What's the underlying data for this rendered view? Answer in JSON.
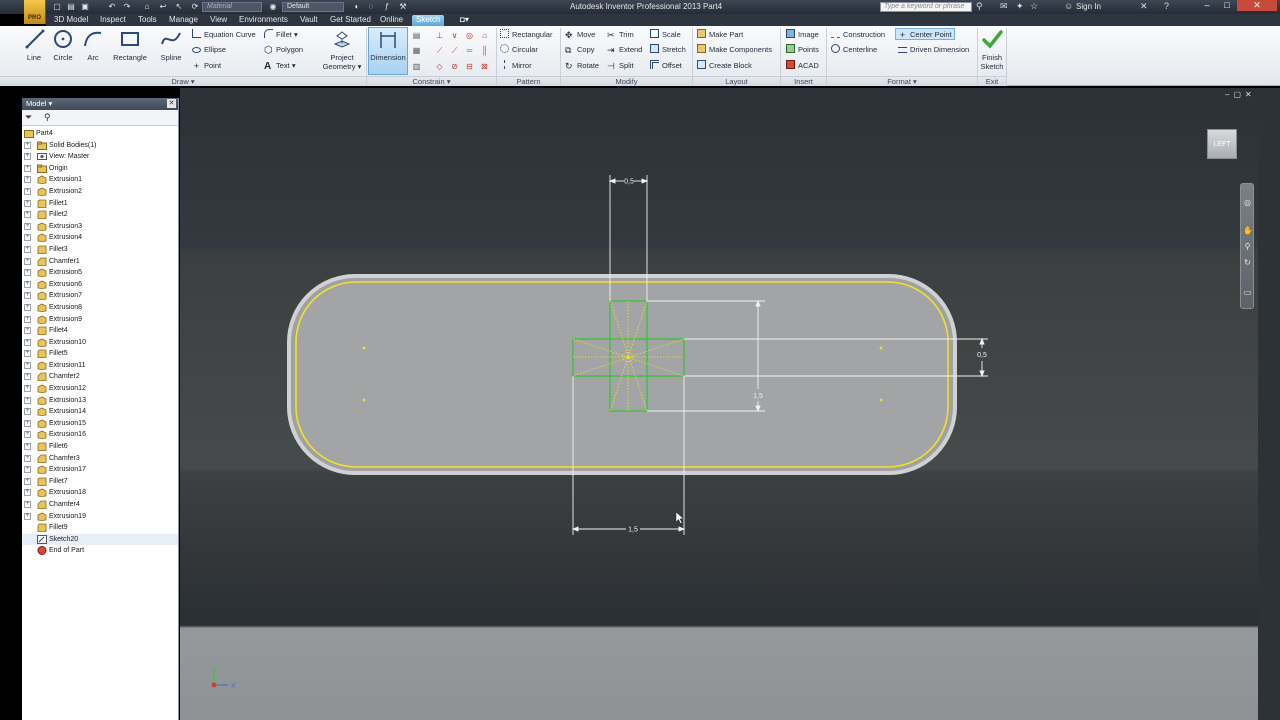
{
  "app": {
    "title": "Autodesk Inventor Professional 2013    Part4",
    "logo_text": "PRO",
    "qa_material": "Material",
    "qa_appearance": "Default",
    "help_placeholder": "Type a keyword or phrase",
    "sign_in": "Sign In"
  },
  "tabs": [
    {
      "label": "3D Model"
    },
    {
      "label": "Inspect"
    },
    {
      "label": "Tools"
    },
    {
      "label": "Manage"
    },
    {
      "label": "View"
    },
    {
      "label": "Environments"
    },
    {
      "label": "Vault"
    },
    {
      "label": "Get Started"
    },
    {
      "label": "Online"
    },
    {
      "label": "Sketch"
    }
  ],
  "ribbon": {
    "draw": {
      "line": "Line",
      "circle": "Circle",
      "arc": "Arc",
      "rectangle": "Rectangle",
      "spline": "Spline",
      "equation_curve": "Equation Curve",
      "ellipse": "Ellipse",
      "point": "Point",
      "fillet": "Fillet",
      "polygon": "Polygon",
      "text": "Text",
      "project_geometry_1": "Project",
      "project_geometry_2": "Geometry"
    },
    "constrain": {
      "dimension": "Dimension"
    },
    "pattern": {
      "rectangular": "Rectangular",
      "circular": "Circular",
      "mirror": "Mirror"
    },
    "modify": {
      "move": "Move",
      "copy": "Copy",
      "rotate": "Rotate",
      "trim": "Trim",
      "extend": "Extend",
      "split": "Split",
      "scale": "Scale",
      "stretch": "Stretch",
      "offset": "Offset"
    },
    "layout": {
      "make_part": "Make Part",
      "make_components": "Make Components",
      "create_block": "Create Block"
    },
    "insert": {
      "image": "Image",
      "points": "Points",
      "acad": "ACAD"
    },
    "format": {
      "construction": "Construction",
      "center_point": "Center Point",
      "centerline": "Centerline",
      "driven_dimension": "Driven Dimension"
    },
    "exit": {
      "finish_1": "Finish",
      "finish_2": "Sketch"
    },
    "panels": {
      "draw": "Draw",
      "constrain": "Constrain",
      "pattern": "Pattern",
      "modify": "Modify",
      "layout": "Layout",
      "insert": "Insert",
      "format": "Format",
      "exit": "Exit"
    }
  },
  "browser": {
    "title": "Model",
    "root": "Part4",
    "items": [
      {
        "label": "Solid Bodies(1)",
        "icon": "folder"
      },
      {
        "label": "View: Master",
        "icon": "view"
      },
      {
        "label": "Origin",
        "icon": "folder"
      },
      {
        "label": "Extrusion1",
        "icon": "extrude"
      },
      {
        "label": "Extrusion2",
        "icon": "extrude"
      },
      {
        "label": "Fillet1",
        "icon": "fillet"
      },
      {
        "label": "Fillet2",
        "icon": "fillet"
      },
      {
        "label": "Extrusion3",
        "icon": "extrude"
      },
      {
        "label": "Extrusion4",
        "icon": "extrude"
      },
      {
        "label": "Fillet3",
        "icon": "fillet"
      },
      {
        "label": "Chamfer1",
        "icon": "chamfer"
      },
      {
        "label": "Extrusion5",
        "icon": "extrude"
      },
      {
        "label": "Extrusion6",
        "icon": "extrude"
      },
      {
        "label": "Extrusion7",
        "icon": "extrude"
      },
      {
        "label": "Extrusion8",
        "icon": "extrude"
      },
      {
        "label": "Extrusion9",
        "icon": "extrude"
      },
      {
        "label": "Fillet4",
        "icon": "fillet"
      },
      {
        "label": "Extrusion10",
        "icon": "extrude"
      },
      {
        "label": "Fillet5",
        "icon": "fillet"
      },
      {
        "label": "Extrusion11",
        "icon": "extrude"
      },
      {
        "label": "Chamfer2",
        "icon": "chamfer"
      },
      {
        "label": "Extrusion12",
        "icon": "extrude"
      },
      {
        "label": "Extrusion13",
        "icon": "extrude"
      },
      {
        "label": "Extrusion14",
        "icon": "extrude"
      },
      {
        "label": "Extrusion15",
        "icon": "extrude"
      },
      {
        "label": "Extrusion16",
        "icon": "extrude"
      },
      {
        "label": "Fillet6",
        "icon": "fillet"
      },
      {
        "label": "Chamfer3",
        "icon": "chamfer"
      },
      {
        "label": "Extrusion17",
        "icon": "extrude"
      },
      {
        "label": "Fillet7",
        "icon": "fillet"
      },
      {
        "label": "Extrusion18",
        "icon": "extrude"
      },
      {
        "label": "Chamfer4",
        "icon": "chamfer"
      },
      {
        "label": "Extrusion19",
        "icon": "extrude"
      },
      {
        "label": "Fillet9",
        "icon": "fillet"
      },
      {
        "label": "Sketch20",
        "icon": "sketch",
        "selected": true
      },
      {
        "label": "End of Part",
        "icon": "end"
      }
    ]
  },
  "viewport": {
    "viewcube_face": "LEFT",
    "dim_top": "0,5",
    "dim_right_vertical": "1,5",
    "dim_right": "0,5",
    "dim_bottom": "1,5",
    "axis_x": "X",
    "axis_z": "Z",
    "colors": {
      "sketch_yellow": "#f2e12a",
      "sketch_green": "#3fc23a",
      "dimension_white": "#f2f2f2",
      "accent_blue": "#5aa8dc"
    }
  }
}
